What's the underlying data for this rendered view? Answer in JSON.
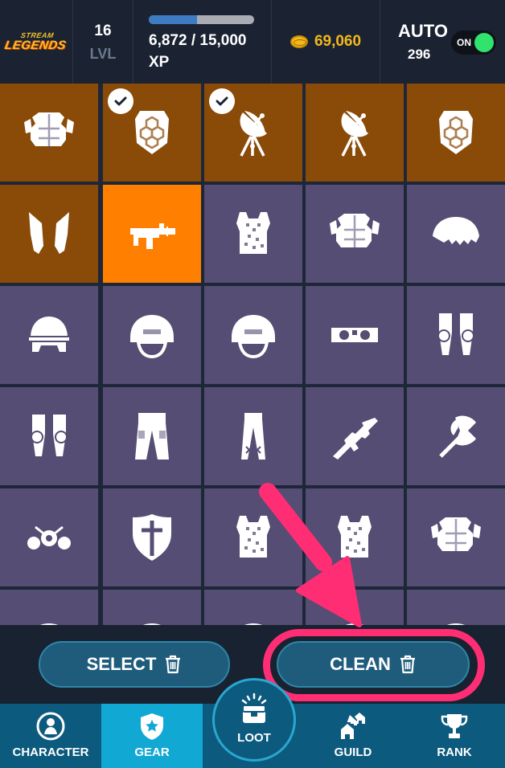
{
  "header": {
    "logo_line1": "STREAM",
    "logo_line2": "LEGENDS",
    "level": "16",
    "level_label": "LVL",
    "xp_value": "6,872 / 15,000",
    "xp_label": "XP",
    "xp_progress": 0.458,
    "gold": "69,060",
    "auto_label": "AUTO",
    "auto_count": "296",
    "auto_toggle": "ON"
  },
  "colors": {
    "tile_brown": "#8a4a08",
    "tile_orange": "#ff7f00",
    "tile_purple": "#554d73",
    "accent_pink": "#ff2e74",
    "nav_active": "#12a8d4"
  },
  "gear_grid": [
    {
      "icon": "chest-armor-icon",
      "bg": "brown",
      "checked": false
    },
    {
      "icon": "turtle-shell-armor-icon",
      "bg": "brown",
      "checked": true
    },
    {
      "icon": "satellite-dish-icon",
      "bg": "brown",
      "checked": true
    },
    {
      "icon": "satellite-dish-icon",
      "bg": "brown",
      "checked": false
    },
    {
      "icon": "turtle-shell-armor-icon",
      "bg": "brown",
      "checked": false
    },
    {
      "icon": "flippers-icon",
      "bg": "brown",
      "checked": false
    },
    {
      "icon": "blaster-gun-icon",
      "bg": "orange",
      "checked": false
    },
    {
      "icon": "camo-vest-icon",
      "bg": "purple",
      "checked": false
    },
    {
      "icon": "chest-armor-icon",
      "bg": "purple",
      "checked": false
    },
    {
      "icon": "fur-shoulders-icon",
      "bg": "purple",
      "checked": false
    },
    {
      "icon": "headband-helmet-icon",
      "bg": "purple",
      "checked": false
    },
    {
      "icon": "combat-helmet-icon",
      "bg": "purple",
      "checked": false
    },
    {
      "icon": "combat-helmet-icon",
      "bg": "purple",
      "checked": false
    },
    {
      "icon": "goggles-icon",
      "bg": "purple",
      "checked": false
    },
    {
      "icon": "knee-pads-icon",
      "bg": "purple",
      "checked": false
    },
    {
      "icon": "knee-pads-icon",
      "bg": "purple",
      "checked": false
    },
    {
      "icon": "cargo-pants-icon",
      "bg": "purple",
      "checked": false
    },
    {
      "icon": "laced-pants-icon",
      "bg": "purple",
      "checked": false
    },
    {
      "icon": "assault-rifle-icon",
      "bg": "purple",
      "checked": false
    },
    {
      "icon": "battle-axe-icon",
      "bg": "purple",
      "checked": false
    },
    {
      "icon": "gadget-icon",
      "bg": "purple",
      "checked": false
    },
    {
      "icon": "cross-shield-icon",
      "bg": "purple",
      "checked": false
    },
    {
      "icon": "camo-vest-icon",
      "bg": "purple",
      "checked": false
    },
    {
      "icon": "camo-vest-icon",
      "bg": "purple",
      "checked": false
    },
    {
      "icon": "chest-armor-icon",
      "bg": "purple",
      "checked": false
    },
    {
      "icon": "gear-item-icon",
      "bg": "purple",
      "checked": false
    },
    {
      "icon": "gear-item-icon",
      "bg": "purple",
      "checked": false
    },
    {
      "icon": "gear-item-icon",
      "bg": "purple",
      "checked": false
    },
    {
      "icon": "gear-item-icon",
      "bg": "purple",
      "checked": false
    },
    {
      "icon": "gear-item-icon",
      "bg": "purple",
      "checked": false
    }
  ],
  "actions": {
    "select_label": "SELECT",
    "clean_label": "CLEAN"
  },
  "nav": {
    "character": "CHARACTER",
    "gear": "GEAR",
    "loot": "LOOT",
    "guild": "GUILD",
    "rank": "RANK"
  }
}
